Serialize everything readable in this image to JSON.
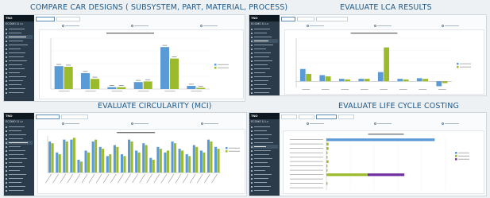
{
  "captions": {
    "design": "COMPARE CAR DESIGNS ( SUBSYSTEM, PART, MATERIAL, PROCESS)",
    "lca": "EVALUATE LCA RESULTS",
    "circularity": "EVALUATE CIRCULARITY (MCI)",
    "lcc": "EVALUATE LIFE CYCLE COSTING"
  },
  "app": {
    "brand": "TNO",
    "model": "ECOMO 11 Lx"
  },
  "colors": {
    "series_a": "#5b9bd5",
    "series_b": "#9bbb2c",
    "series_c": "#7030a0",
    "sidebar": "#2c3b4a",
    "caption": "#1e5a8a"
  },
  "chart_data": [
    {
      "type": "bar",
      "categories": [
        "",
        "",
        "",
        "",
        "",
        ""
      ],
      "series": [
        {
          "name": "",
          "values": [
            3.6,
            2.5,
            0.3,
            1.1,
            6.6,
            0.5
          ]
        },
        {
          "name": "",
          "values": [
            3.5,
            1.6,
            0.3,
            1.2,
            4.8,
            0.2
          ]
        }
      ],
      "ylim": [
        0,
        8
      ],
      "legend": "right"
    },
    {
      "type": "bar",
      "categories": [
        "",
        "",
        "",
        "",
        "",
        "",
        "",
        ""
      ],
      "series": [
        {
          "name": "",
          "values": [
            2.0,
            1.0,
            0.4,
            0.4,
            1.5,
            0.4,
            0.5,
            -0.8
          ]
        },
        {
          "name": "",
          "values": [
            1.2,
            0.8,
            0.3,
            0.4,
            5.5,
            0.3,
            0.4,
            -0.3
          ]
        }
      ],
      "ylim": [
        -1,
        7
      ],
      "legend": "right"
    },
    {
      "type": "bar",
      "categories": [
        "",
        "",
        "",
        "",
        "",
        "",
        "",
        "",
        "",
        "",
        "",
        "",
        "",
        "",
        "",
        "",
        "",
        "",
        "",
        "",
        "",
        "",
        "",
        ""
      ],
      "series": [
        {
          "name": "",
          "values": [
            0.85,
            0.55,
            0.9,
            0.9,
            0.35,
            0.6,
            0.85,
            0.7,
            0.45,
            0.75,
            0.5,
            0.9,
            0.6,
            0.8,
            0.4,
            0.7,
            0.55,
            0.85,
            0.65,
            0.5,
            0.75,
            0.6,
            0.9,
            0.7
          ]
        },
        {
          "name": "",
          "values": [
            0.8,
            0.5,
            0.85,
            0.95,
            0.3,
            0.55,
            0.9,
            0.65,
            0.5,
            0.7,
            0.45,
            0.85,
            0.55,
            0.75,
            0.35,
            0.65,
            0.6,
            0.8,
            0.6,
            0.45,
            0.7,
            0.55,
            0.85,
            0.65
          ]
        }
      ],
      "ylim": [
        0,
        1
      ],
      "legend": "right"
    },
    {
      "type": "bar",
      "orientation": "horizontal",
      "categories": [
        "",
        "",
        "",
        "",
        "",
        "",
        "",
        "",
        "",
        "",
        "",
        ""
      ],
      "series": [
        {
          "name": "",
          "values": [
            100,
            0,
            0,
            0,
            0,
            0,
            0,
            0,
            0,
            0,
            0,
            0
          ]
        },
        {
          "name": "",
          "values": [
            0,
            2,
            2,
            1,
            1,
            2,
            1,
            1,
            38,
            0,
            1,
            0
          ]
        },
        {
          "name": "",
          "values": [
            0,
            0,
            0,
            0,
            0,
            0,
            0,
            0,
            34,
            0,
            0,
            0
          ]
        }
      ],
      "xlim": [
        0,
        110
      ],
      "legend": "right"
    }
  ]
}
